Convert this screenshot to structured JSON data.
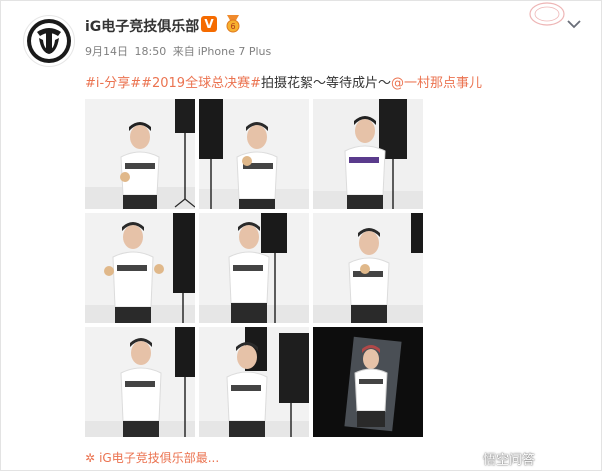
{
  "post": {
    "username": "iG电子竞技俱乐部",
    "verified_badge": "V",
    "date": "9月14日",
    "time": "18:50",
    "source_prefix": "来自",
    "source_device": "iPhone 7 Plus",
    "hashtags": [
      "#i-分享#",
      "#2019全球总决赛#"
    ],
    "text": "拍摄花絮～等待成片～",
    "mention": "@一村那点事儿"
  },
  "photos": [
    {
      "name": "photo-1"
    },
    {
      "name": "photo-2"
    },
    {
      "name": "photo-3"
    },
    {
      "name": "photo-4"
    },
    {
      "name": "photo-5"
    },
    {
      "name": "photo-6"
    },
    {
      "name": "photo-7"
    },
    {
      "name": "photo-8"
    },
    {
      "name": "photo-9"
    }
  ],
  "footer": {
    "icon": "sun-icon",
    "label": "iG电子竞技俱乐部最..."
  },
  "watermark": {
    "text": "悟空问答"
  },
  "colors": {
    "link": "#eb7350",
    "vip_badge": "#f56b00",
    "text": "#333333",
    "meta": "#808080"
  }
}
